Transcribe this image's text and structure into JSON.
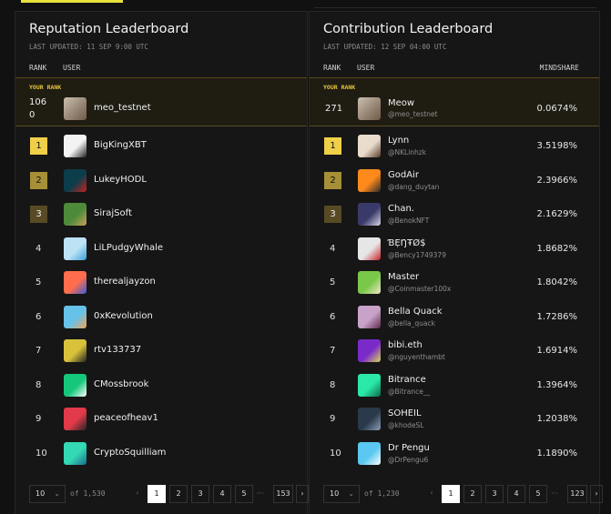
{
  "colors": {
    "accent": "#e7e13c",
    "gold": "#f0cf49",
    "silver": "#a68f37",
    "bronze": "#584a24",
    "highlight_border": "#5a4a1c"
  },
  "reputation": {
    "title": "Reputation Leaderboard",
    "updated": "LAST UPDATED: 11 SEP 9:00 UTC",
    "col_rank": "RANK",
    "col_user": "USER",
    "your_rank_label": "YOUR RANK",
    "your": {
      "rank_line1": "106",
      "rank_line2": "0",
      "name": "meo_testnet"
    },
    "rows": [
      {
        "rank": "1",
        "name": "BigKingXBT"
      },
      {
        "rank": "2",
        "name": "LukeyHODL"
      },
      {
        "rank": "3",
        "name": "SirajSoft"
      },
      {
        "rank": "4",
        "name": "LiLPudgyWhale"
      },
      {
        "rank": "5",
        "name": "therealjayzon"
      },
      {
        "rank": "6",
        "name": "0xKevolution"
      },
      {
        "rank": "7",
        "name": "rtv133737"
      },
      {
        "rank": "8",
        "name": "CMossbrook"
      },
      {
        "rank": "9",
        "name": "peaceofheav1"
      },
      {
        "rank": "10",
        "name": "CryptoSquilliam"
      }
    ],
    "pager": {
      "per_page": "10",
      "of_text": "of 1,530",
      "pages": [
        "1",
        "2",
        "3",
        "4",
        "5"
      ],
      "ellipsis": "···",
      "last": "153",
      "prev": "‹",
      "next": "›"
    }
  },
  "contribution": {
    "title": "Contribution Leaderboard",
    "updated": "LAST UPDATED: 12 SEP 04:00 UTC",
    "col_rank": "RANK",
    "col_user": "USER",
    "col_mind": "MINDSHARE",
    "your_rank_label": "YOUR RANK",
    "your": {
      "rank": "271",
      "name": "Meow",
      "handle": "@meo_testnet",
      "mind": "0.0674%"
    },
    "rows": [
      {
        "rank": "1",
        "name": "Lynn",
        "handle": "@NKLinhzk",
        "mind": "3.5198%"
      },
      {
        "rank": "2",
        "name": "GodAir",
        "handle": "@dang_duytan",
        "mind": "2.3966%"
      },
      {
        "rank": "3",
        "name": "Chan.",
        "handle": "@BenokNFT",
        "mind": "2.1629%"
      },
      {
        "rank": "4",
        "name": "ƁẸŊŦØ$",
        "handle": "@Bency1749379",
        "mind": "1.8682%"
      },
      {
        "rank": "5",
        "name": "Master",
        "handle": "@Coinmaster100x",
        "mind": "1.8042%"
      },
      {
        "rank": "6",
        "name": "Bella Quack",
        "handle": "@bella_quack",
        "mind": "1.7286%"
      },
      {
        "rank": "7",
        "name": "bibi.eth",
        "handle": "@nguyenthambt",
        "mind": "1.6914%"
      },
      {
        "rank": "8",
        "name": "Bitrance",
        "handle": "@Bitrance__",
        "mind": "1.3964%"
      },
      {
        "rank": "9",
        "name": "SOHEIL",
        "handle": "@khodeSL",
        "mind": "1.2038%"
      },
      {
        "rank": "10",
        "name": "Dr Pengu",
        "handle": "@DrPengu6",
        "mind": "1.1890%"
      }
    ],
    "pager": {
      "per_page": "10",
      "of_text": "of 1,230",
      "pages": [
        "1",
        "2",
        "3",
        "4",
        "5"
      ],
      "ellipsis": "···",
      "last": "123",
      "prev": "‹",
      "next": "›"
    }
  }
}
